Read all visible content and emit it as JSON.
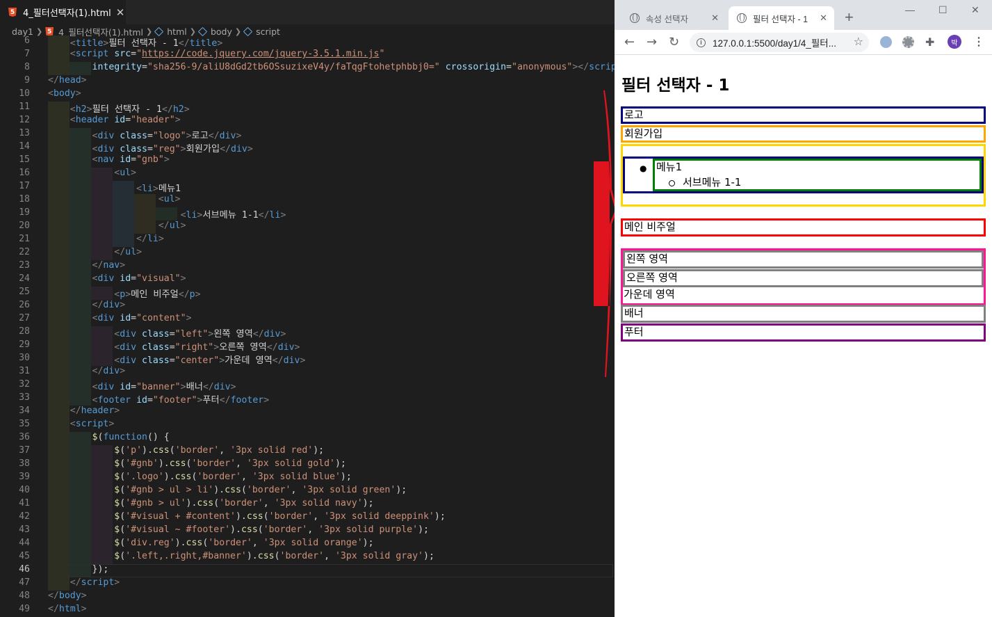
{
  "editor": {
    "tab_title": "4_필터선택자(1).html",
    "tab_close": "✕",
    "html_icon_letter": "5",
    "breadcrumb": [
      "day1",
      "4_필터선택자(1).html",
      "html",
      "body",
      "script"
    ],
    "lines": [
      {
        "n": "6",
        "html": "    <span class='b'>&lt;</span><span class='t'>title</span><span class='b'>&gt;</span>필터 선택자 - 1<span class='b'>&lt;/</span><span class='t'>title</span><span class='b'>&gt;</span>"
      },
      {
        "n": "7",
        "html": "    <span class='b'>&lt;</span><span class='t'>script</span> <span class='a'>src</span>=<span class='s'>\"<u>https://code.jquery.com/jquery-3.5.1.min.js</u>\"</span>"
      },
      {
        "n": "8",
        "html": "        <span class='a'>integrity</span>=<span class='s'>\"sha256-9/aliU8dGd2tb6OSsuzixeV4y/faTqgFtohetphbbj0=\"</span> <span class='a'>crossorigin</span>=<span class='s'>\"anonymous\"</span><span class='b'>&gt;&lt;/</span><span class='t'>script</span><span class='b'>&gt;</span>"
      },
      {
        "n": "9",
        "html": "<span class='b'>&lt;/</span><span class='t'>head</span><span class='b'>&gt;</span>"
      },
      {
        "n": "10",
        "html": "<span class='b'>&lt;</span><span class='t'>body</span><span class='b'>&gt;</span>"
      },
      {
        "n": "11",
        "html": "    <span class='b'>&lt;</span><span class='t'>h2</span><span class='b'>&gt;</span>필터 선택자 - 1<span class='b'>&lt;/</span><span class='t'>h2</span><span class='b'>&gt;</span>"
      },
      {
        "n": "12",
        "html": "    <span class='b'>&lt;</span><span class='t'>header</span> <span class='a'>id</span>=<span class='s'>\"header\"</span><span class='b'>&gt;</span>"
      },
      {
        "n": "13",
        "html": "        <span class='b'>&lt;</span><span class='t'>div</span> <span class='a'>class</span>=<span class='s'>\"logo\"</span><span class='b'>&gt;</span>로고<span class='b'>&lt;/</span><span class='t'>div</span><span class='b'>&gt;</span>"
      },
      {
        "n": "14",
        "html": "        <span class='b'>&lt;</span><span class='t'>div</span> <span class='a'>class</span>=<span class='s'>\"reg\"</span><span class='b'>&gt;</span>회원가입<span class='b'>&lt;/</span><span class='t'>div</span><span class='b'>&gt;</span>"
      },
      {
        "n": "15",
        "html": "        <span class='b'>&lt;</span><span class='t'>nav</span> <span class='a'>id</span>=<span class='s'>\"gnb\"</span><span class='b'>&gt;</span>"
      },
      {
        "n": "16",
        "html": "            <span class='b'>&lt;</span><span class='t'>ul</span><span class='b'>&gt;</span>"
      },
      {
        "n": "17",
        "html": "                <span class='b'>&lt;</span><span class='t'>li</span><span class='b'>&gt;</span>메뉴1"
      },
      {
        "n": "18",
        "html": "                    <span class='b'>&lt;</span><span class='t'>ul</span><span class='b'>&gt;</span>"
      },
      {
        "n": "19",
        "html": "                        <span class='b'>&lt;</span><span class='t'>li</span><span class='b'>&gt;</span>서브메뉴 1-1<span class='b'>&lt;/</span><span class='t'>li</span><span class='b'>&gt;</span>"
      },
      {
        "n": "20",
        "html": "                    <span class='b'>&lt;/</span><span class='t'>ul</span><span class='b'>&gt;</span>"
      },
      {
        "n": "21",
        "html": "                <span class='b'>&lt;/</span><span class='t'>li</span><span class='b'>&gt;</span>"
      },
      {
        "n": "22",
        "html": "            <span class='b'>&lt;/</span><span class='t'>ul</span><span class='b'>&gt;</span>"
      },
      {
        "n": "23",
        "html": "        <span class='b'>&lt;/</span><span class='t'>nav</span><span class='b'>&gt;</span>"
      },
      {
        "n": "24",
        "html": "        <span class='b'>&lt;</span><span class='t'>div</span> <span class='a'>id</span>=<span class='s'>\"visual\"</span><span class='b'>&gt;</span>"
      },
      {
        "n": "25",
        "html": "            <span class='b'>&lt;</span><span class='t'>p</span><span class='b'>&gt;</span>메인 비주얼<span class='b'>&lt;/</span><span class='t'>p</span><span class='b'>&gt;</span>"
      },
      {
        "n": "26",
        "html": "        <span class='b'>&lt;/</span><span class='t'>div</span><span class='b'>&gt;</span>"
      },
      {
        "n": "27",
        "html": "        <span class='b'>&lt;</span><span class='t'>div</span> <span class='a'>id</span>=<span class='s'>\"content\"</span><span class='b'>&gt;</span>"
      },
      {
        "n": "28",
        "html": "            <span class='b'>&lt;</span><span class='t'>div</span> <span class='a'>class</span>=<span class='s'>\"left\"</span><span class='b'>&gt;</span>왼쪽 영역<span class='b'>&lt;/</span><span class='t'>div</span><span class='b'>&gt;</span>"
      },
      {
        "n": "29",
        "html": "            <span class='b'>&lt;</span><span class='t'>div</span> <span class='a'>class</span>=<span class='s'>\"right\"</span><span class='b'>&gt;</span>오른쪽 영역<span class='b'>&lt;/</span><span class='t'>div</span><span class='b'>&gt;</span>"
      },
      {
        "n": "30",
        "html": "            <span class='b'>&lt;</span><span class='t'>div</span> <span class='a'>class</span>=<span class='s'>\"center\"</span><span class='b'>&gt;</span>가운데 영역<span class='b'>&lt;/</span><span class='t'>div</span><span class='b'>&gt;</span>"
      },
      {
        "n": "31",
        "html": "        <span class='b'>&lt;/</span><span class='t'>div</span><span class='b'>&gt;</span>"
      },
      {
        "n": "32",
        "html": "        <span class='b'>&lt;</span><span class='t'>div</span> <span class='a'>id</span>=<span class='s'>\"banner\"</span><span class='b'>&gt;</span>배너<span class='b'>&lt;/</span><span class='t'>div</span><span class='b'>&gt;</span>"
      },
      {
        "n": "33",
        "html": "        <span class='b'>&lt;</span><span class='t'>footer</span> <span class='a'>id</span>=<span class='s'>\"footer\"</span><span class='b'>&gt;</span>푸터<span class='b'>&lt;/</span><span class='t'>footer</span><span class='b'>&gt;</span>"
      },
      {
        "n": "34",
        "html": "    <span class='b'>&lt;/</span><span class='t'>header</span><span class='b'>&gt;</span>"
      },
      {
        "n": "35",
        "html": "    <span class='b'>&lt;</span><span class='t'>script</span><span class='b'>&gt;</span>"
      },
      {
        "n": "36",
        "html": "        <span class='f'>$</span>(<span class='k'>function</span>() {"
      },
      {
        "n": "37",
        "html": "            <span class='f'>$</span>(<span class='s'>'p'</span>).<span class='f'>css</span>(<span class='s'>'border'</span>, <span class='s'>'3px solid red'</span>);"
      },
      {
        "n": "38",
        "html": "            <span class='f'>$</span>(<span class='s'>'#gnb'</span>).<span class='f'>css</span>(<span class='s'>'border'</span>, <span class='s'>'3px solid gold'</span>);"
      },
      {
        "n": "39",
        "html": "            <span class='f'>$</span>(<span class='s'>'.logo'</span>).<span class='f'>css</span>(<span class='s'>'border'</span>, <span class='s'>'3px solid blue'</span>);"
      },
      {
        "n": "40",
        "html": "            <span class='f'>$</span>(<span class='s'>'#gnb &gt; ul &gt; li'</span>).<span class='f'>css</span>(<span class='s'>'border'</span>, <span class='s'>'3px solid green'</span>);"
      },
      {
        "n": "41",
        "html": "            <span class='f'>$</span>(<span class='s'>'#gnb &gt; ul'</span>).<span class='f'>css</span>(<span class='s'>'border'</span>, <span class='s'>'3px solid navy'</span>);"
      },
      {
        "n": "42",
        "html": "            <span class='f'>$</span>(<span class='s'>'#visual + #content'</span>).<span class='f'>css</span>(<span class='s'>'border'</span>, <span class='s'>'3px solid deeppink'</span>);"
      },
      {
        "n": "43",
        "html": "            <span class='f'>$</span>(<span class='s'>'#visual ~ #footer'</span>).<span class='f'>css</span>(<span class='s'>'border'</span>, <span class='s'>'3px solid purple'</span>);"
      },
      {
        "n": "44",
        "html": "            <span class='f'>$</span>(<span class='s'>'div.reg'</span>).<span class='f'>css</span>(<span class='s'>'border'</span>, <span class='s'>'3px solid orange'</span>);"
      },
      {
        "n": "45",
        "html": "            <span class='f'>$</span>(<span class='s'>'.left,.right,#banner'</span>).<span class='f'>css</span>(<span class='s'>'border'</span>, <span class='s'>'3px solid gray'</span>);"
      },
      {
        "n": "46",
        "html": "        });",
        "current": true
      },
      {
        "n": "47",
        "html": "    <span class='b'>&lt;/</span><span class='t'>script</span><span class='b'>&gt;</span>"
      },
      {
        "n": "48",
        "html": "<span class='b'>&lt;/</span><span class='t'>body</span><span class='b'>&gt;</span>"
      },
      {
        "n": "49",
        "html": "<span class='b'>&lt;/</span><span class='t'>html</span><span class='b'>&gt;</span>"
      }
    ]
  },
  "browser": {
    "tabs": [
      {
        "title": "속성 선택자",
        "close": "✕"
      },
      {
        "title": "필터 선택자 - 1",
        "close": "✕"
      }
    ],
    "new_tab": "+",
    "window_controls": {
      "minimize": "—",
      "maximize": "☐",
      "close": "✕"
    },
    "url": "127.0.0.1:5500/day1/4_필터...",
    "profile_initial": "박",
    "page": {
      "heading": "필터 선택자 - 1",
      "logo": "로고",
      "reg": "회원가입",
      "menu1": "메뉴1",
      "submenu": "서브메뉴 1-1",
      "visual": "메인 비주얼",
      "left": "왼쪽 영역",
      "right": "오른쪽 영역",
      "center": "가운데 영역",
      "banner": "배너",
      "footer": "푸터"
    }
  },
  "colors": {
    "arrow": "#e0141e",
    "navy": "#000080",
    "gold": "#ffd700",
    "orange": "#ffa500",
    "blue": "#0000ff",
    "green": "#008000",
    "red": "#ff0000",
    "deeppink": "#ff1493",
    "gray": "#808080",
    "purple": "#800080"
  }
}
